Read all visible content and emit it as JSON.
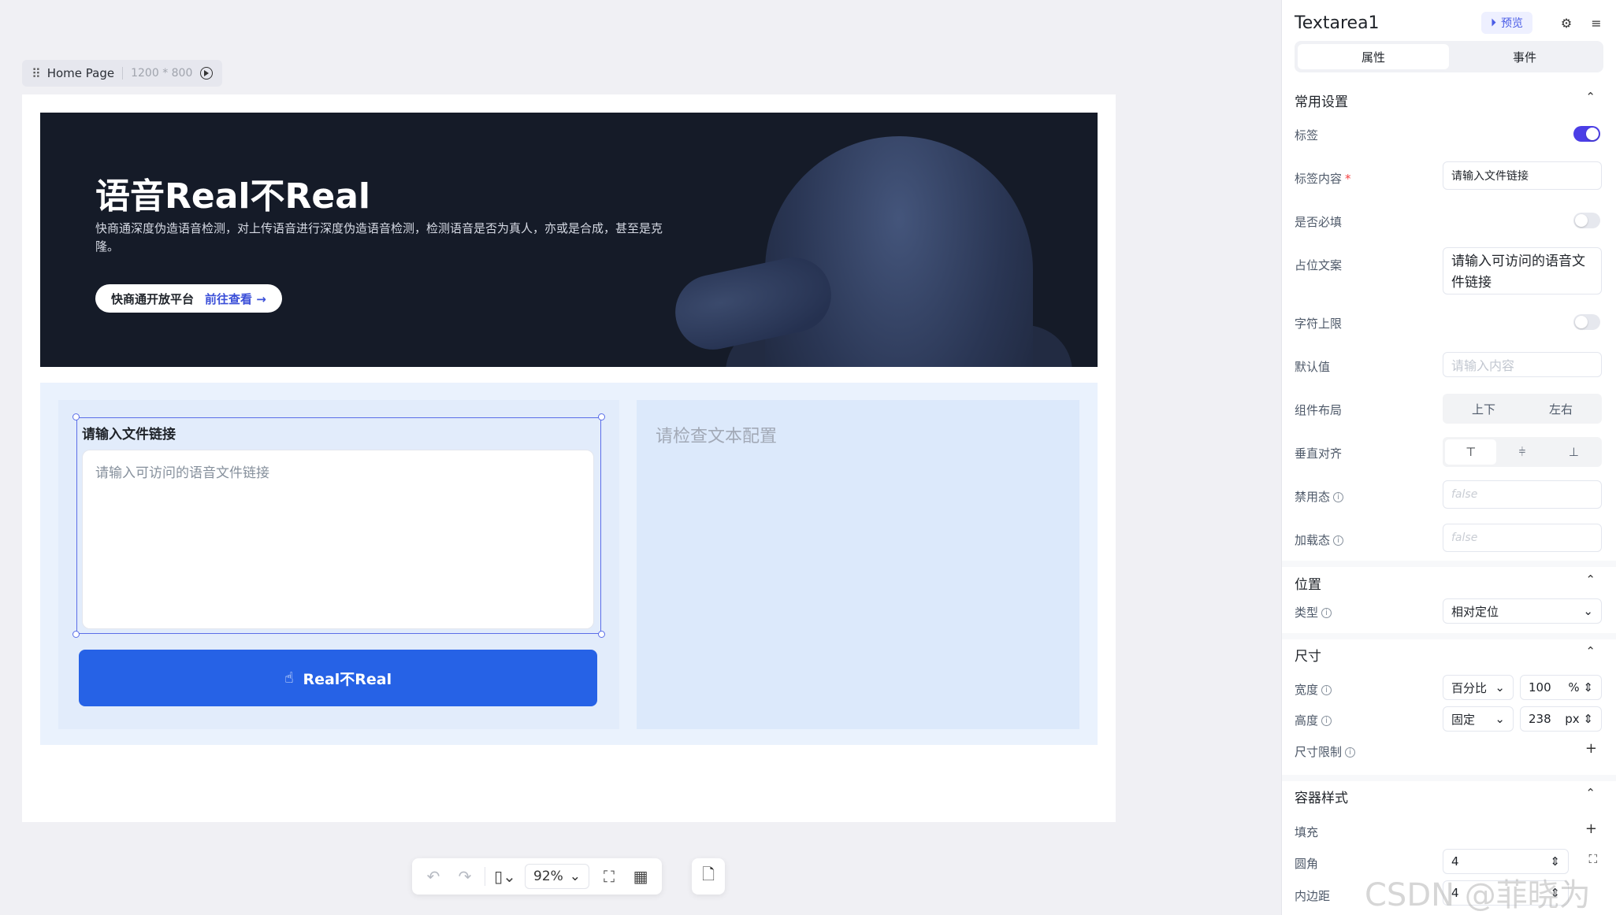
{
  "canvas": {
    "page_name": "Home Page",
    "page_size": "1200 * 800"
  },
  "banner": {
    "title": "语音Real不Real",
    "description": "快商通深度伪造语音检测，对上传语音进行深度伪造语音检测，检测语音是否为真人，亦或是合成，甚至是克隆。",
    "cta_platform": "快商通开放平台",
    "cta_link": "前往查看"
  },
  "form": {
    "textarea_label": "请输入文件链接",
    "textarea_placeholder": "请输入可访问的语音文件链接",
    "submit_label": "Real不Real",
    "result_hint": "请检查文本配置"
  },
  "toolbar": {
    "zoom": "92%"
  },
  "panel": {
    "title": "Textarea1",
    "preview_label": "预览",
    "tabs": [
      {
        "label": "属性",
        "active": true
      },
      {
        "label": "事件",
        "active": false
      }
    ],
    "common": {
      "section_title": "常用设置",
      "label_toggle": "标签",
      "label_content_label": "标签内容",
      "label_content_value": "请输入文件链接",
      "required_label": "是否必填",
      "placeholder_label": "占位文案",
      "placeholder_value": "请输入可访问的语音文件链接",
      "maxlength_label": "字符上限",
      "default_label": "默认值",
      "default_placeholder": "请输入内容",
      "layout_label": "组件布局",
      "layout_options": [
        "上下",
        "左右"
      ],
      "valign_label": "垂直对齐",
      "disabled_label": "禁用态",
      "disabled_value": "false",
      "loading_label": "加载态",
      "loading_value": "false"
    },
    "position": {
      "section_title": "位置",
      "type_label": "类型",
      "type_value": "相对定位"
    },
    "size": {
      "section_title": "尺寸",
      "width_label": "宽度",
      "width_mode": "百分比",
      "width_value": "100",
      "width_unit": "%",
      "height_label": "高度",
      "height_mode": "固定",
      "height_value": "238",
      "height_unit": "px",
      "limit_label": "尺寸限制"
    },
    "container": {
      "section_title": "容器样式",
      "fill_label": "填充",
      "radius_label": "圆角",
      "radius_value": "4",
      "padding_label": "内边距",
      "padding_value": "4"
    }
  },
  "watermark": "CSDN @菲晓为晓",
  "colors": {
    "accent": "#4b3ee6",
    "primary_button": "#2662e6",
    "banner_bg": "#151b28"
  }
}
